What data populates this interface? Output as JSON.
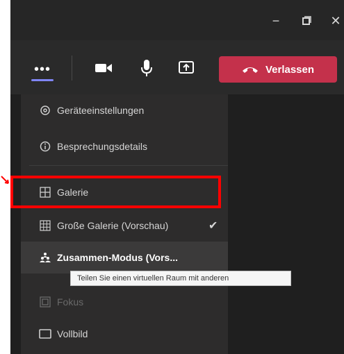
{
  "window_controls": {
    "minimize_glyph": "−",
    "restore_glyph": "❐",
    "close_glyph": "✕"
  },
  "toolbar": {
    "more_glyph": "•••",
    "leave_label": "Verlassen",
    "leave_color": "#c4314b",
    "active_underline_color": "#7f85f5"
  },
  "menu": {
    "items": [
      {
        "label": "Geräteeinstellungen",
        "icon": "gear-icon"
      },
      {
        "label": "Besprechungsdetails",
        "icon": "info-icon"
      },
      {
        "label": "Galerie",
        "icon": "gallery-grid-icon"
      },
      {
        "label": "Große Galerie (Vorschau)",
        "icon": "large-gallery-icon",
        "checked": true
      },
      {
        "label": "Zusammen-Modus (Vors...",
        "icon": "together-mode-icon"
      },
      {
        "label": "Fokus",
        "icon": "focus-icon",
        "disabled": true
      },
      {
        "label": "Vollbild",
        "icon": "fullscreen-icon"
      }
    ]
  },
  "tooltip": {
    "text": "Teilen Sie einen virtuellen Raum mit anderen"
  },
  "highlight_color": "#ff0000"
}
